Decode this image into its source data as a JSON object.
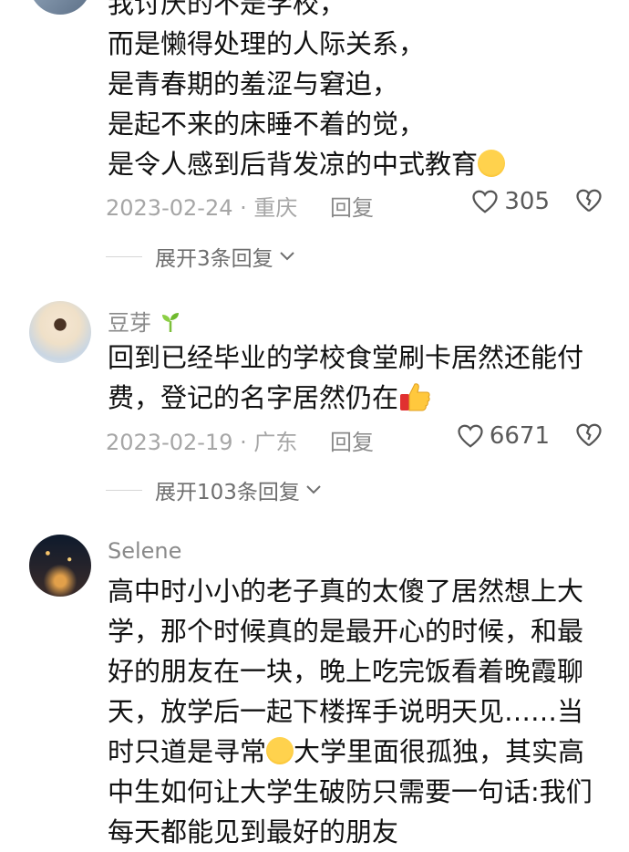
{
  "comments": [
    {
      "lines": [
        "我讨厌的不是学校，",
        "而是懒得处理的人际关系，",
        "是青春期的羞涩与窘迫，",
        "是起不来的床睡不着的觉，",
        "是令人感到后背发凉的中式教育"
      ],
      "date": "2023-02-24",
      "location": "重庆",
      "reply_label": "回复",
      "likes": "305",
      "expand_label": "展开3条回复"
    },
    {
      "username": "豆芽",
      "lines": [
        "回到已经毕业的学校食堂刷卡居然还能付",
        "费，登记的名字居然仍在"
      ],
      "date": "2023-02-19",
      "location": "广东",
      "reply_label": "回复",
      "likes": "6671",
      "expand_label": "展开103条回复"
    },
    {
      "username": "Selene",
      "lines": [
        "高中时小小的老子真的太傻了居然想上大",
        "学，那个时候真的是最开心的时候，和最",
        "好的朋友在一块，晚上吃完饭看着晚霞聊",
        "天，放学后一起下楼挥手说明天见……当",
        "时只道是寻常",
        "大学里面很孤独，其实高",
        "中生如何让大学生破防只需要一句话:我们",
        "每天都能见到最好的朋友"
      ]
    }
  ],
  "icons": {
    "like": "heart-outline-icon",
    "dislike": "broken-heart-icon",
    "cry": "crying-emoji-icon",
    "thumb": "thumbs-up-emoji-icon",
    "sprout": "sprout-emoji-icon"
  }
}
